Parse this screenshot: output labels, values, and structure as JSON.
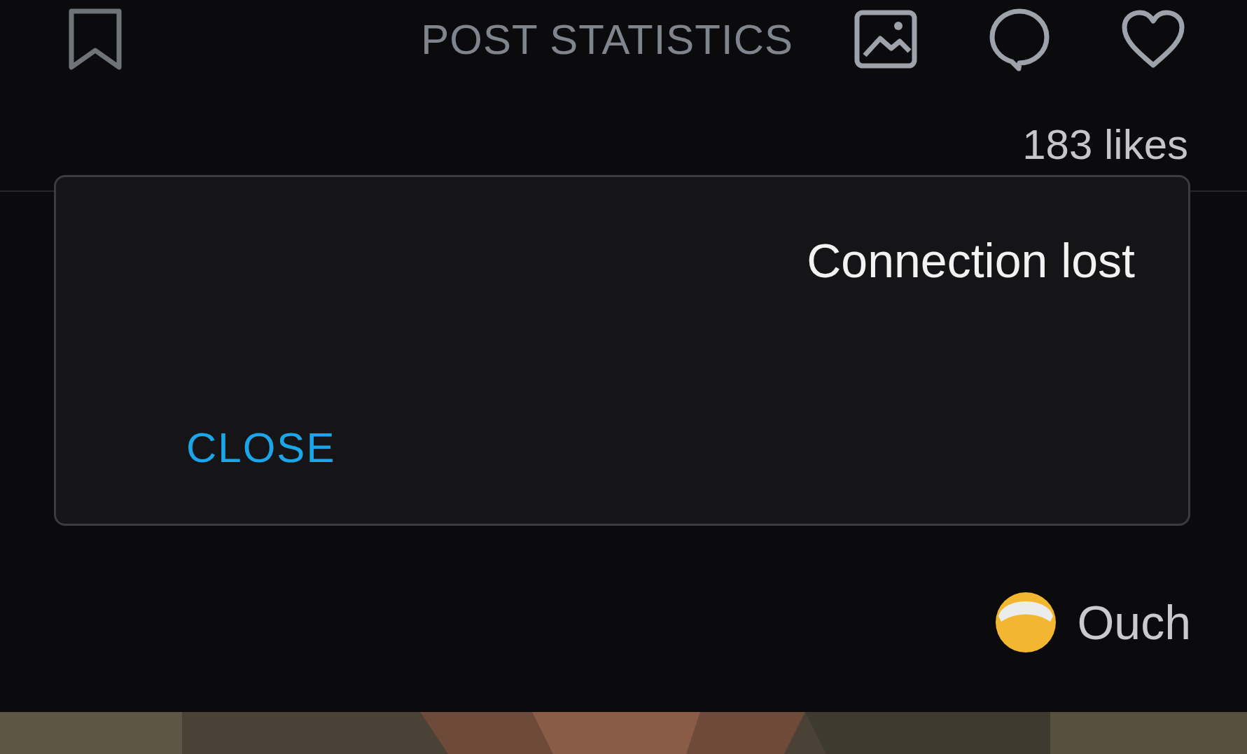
{
  "toolbar": {
    "title": "POST STATISTICS"
  },
  "likes": "183 likes",
  "dialog": {
    "message": "Connection lost",
    "button": "CLOSE"
  },
  "comment": {
    "text": "Ouch"
  }
}
